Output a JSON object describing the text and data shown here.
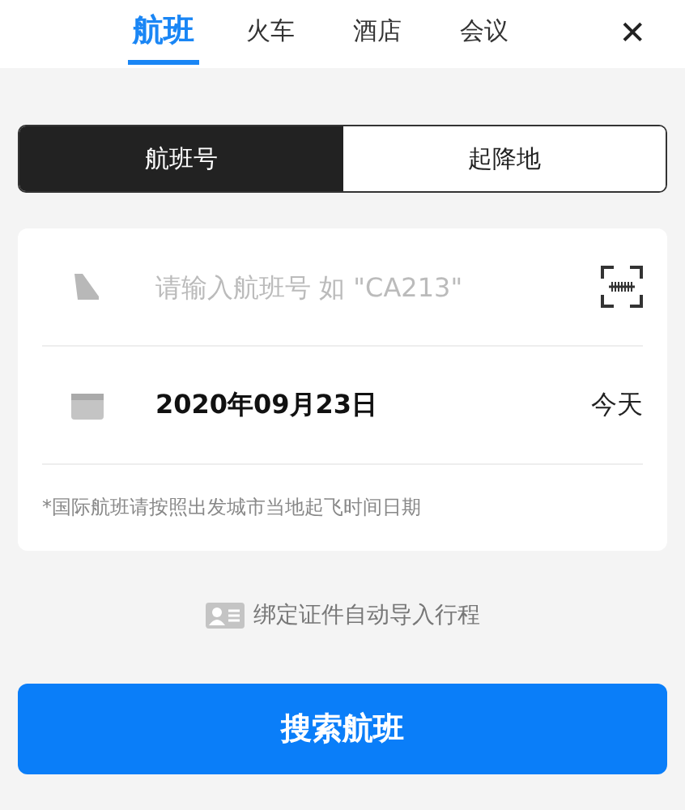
{
  "tabs": [
    {
      "label": "航班",
      "selected": true
    },
    {
      "label": "火车",
      "selected": false
    },
    {
      "label": "酒店",
      "selected": false
    },
    {
      "label": "会议",
      "selected": false
    }
  ],
  "close": "✕",
  "segments": [
    {
      "label": "航班号",
      "selected": true
    },
    {
      "label": "起降地",
      "selected": false
    }
  ],
  "flight_field": {
    "placeholder": "请输入航班号 如 \"CA213\""
  },
  "date": {
    "value": "2020年09月23日",
    "relative": "今天"
  },
  "note": "*国际航班请按照出发城市当地起飞时间日期",
  "bind_link": "绑定证件自动导入行程",
  "search_button": "搜索航班"
}
